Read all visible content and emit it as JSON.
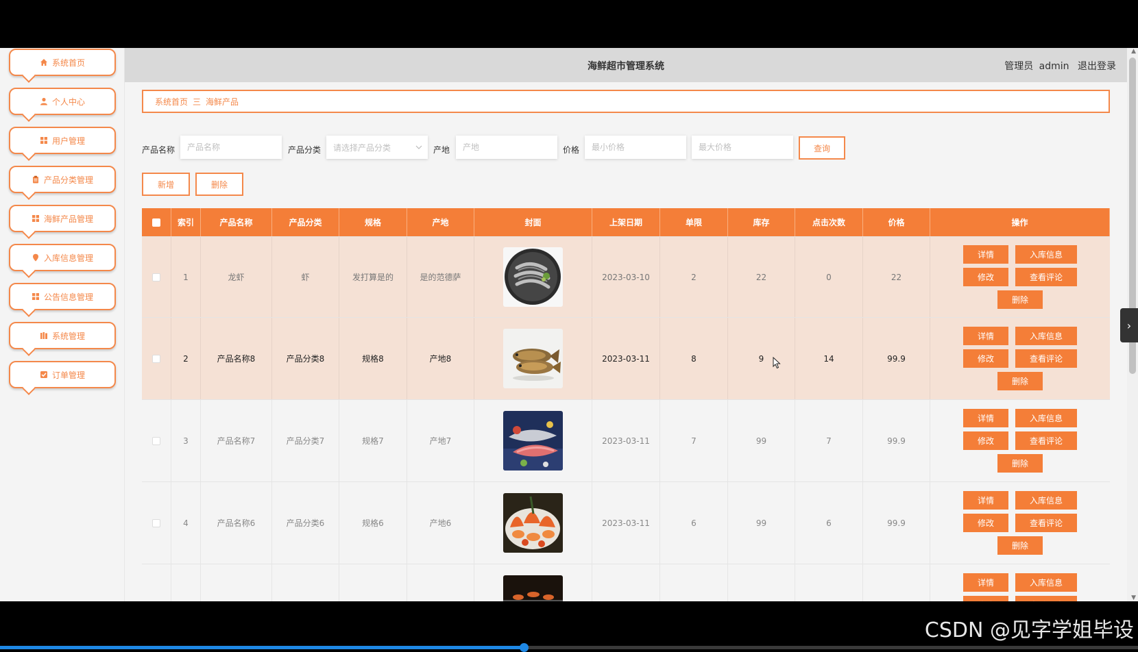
{
  "app_title": "海鲜超市管理系统",
  "header": {
    "role": "管理员",
    "user": "admin",
    "logout": "退出登录"
  },
  "sidebar": {
    "items": [
      {
        "label": "系统首页",
        "icon": "home-icon"
      },
      {
        "label": "个人中心",
        "icon": "user-icon"
      },
      {
        "label": "用户管理",
        "icon": "grid-icon"
      },
      {
        "label": "产品分类管理",
        "icon": "clipboard-icon"
      },
      {
        "label": "海鲜产品管理",
        "icon": "grid-icon"
      },
      {
        "label": "入库信息管理",
        "icon": "pin-icon"
      },
      {
        "label": "公告信息管理",
        "icon": "grid-icon"
      },
      {
        "label": "系统管理",
        "icon": "books-icon"
      },
      {
        "label": "订单管理",
        "icon": "check-icon"
      }
    ]
  },
  "breadcrumb": {
    "home": "系统首页",
    "sep": "三",
    "current": "海鲜产品"
  },
  "search": {
    "name_label": "产品名称",
    "name_placeholder": "产品名称",
    "category_label": "产品分类",
    "category_placeholder": "请选择产品分类",
    "origin_label": "产地",
    "origin_placeholder": "产地",
    "price_label": "价格",
    "min_price_placeholder": "最小价格",
    "max_price_placeholder": "最大价格",
    "query_button": "查询"
  },
  "actions": {
    "add": "新增",
    "delete": "删除"
  },
  "table": {
    "columns": [
      "索引",
      "产品名称",
      "产品分类",
      "规格",
      "产地",
      "封面",
      "上架日期",
      "单限",
      "库存",
      "点击次数",
      "价格",
      "操作"
    ],
    "op_labels": {
      "detail": "详情",
      "stock": "入库信息",
      "edit": "修改",
      "comments": "查看评论",
      "delete": "删除"
    },
    "rows": [
      {
        "index": "1",
        "name": "龙虾",
        "category": "虾",
        "spec": "发打算是的",
        "origin": "是的范德萨",
        "cover": "shrimp-image",
        "date": "2023-03-10",
        "limit": "2",
        "stock": "22",
        "clicks": "0",
        "price": "22"
      },
      {
        "index": "2",
        "name": "产品名称8",
        "category": "产品分类8",
        "spec": "规格8",
        "origin": "产地8",
        "cover": "fish-image",
        "date": "2023-03-11",
        "limit": "8",
        "stock": "9",
        "clicks": "14",
        "price": "99.9"
      },
      {
        "index": "3",
        "name": "产品名称7",
        "category": "产品分类7",
        "spec": "规格7",
        "origin": "产地7",
        "cover": "salmon-image",
        "date": "2023-03-11",
        "limit": "7",
        "stock": "99",
        "clicks": "7",
        "price": "99.9"
      },
      {
        "index": "4",
        "name": "产品名称6",
        "category": "产品分类6",
        "spec": "规格6",
        "origin": "产地6",
        "cover": "seafood-platter-image",
        "date": "2023-03-11",
        "limit": "6",
        "stock": "99",
        "clicks": "6",
        "price": "99.9"
      },
      {
        "index": "",
        "name": "",
        "category": "",
        "spec": "",
        "origin": "",
        "cover": "grill-image",
        "date": "",
        "limit": "",
        "stock": "",
        "clicks": "",
        "price": ""
      }
    ]
  },
  "watermark": "CSDN @见字学姐毕设",
  "video_progress": 0.46,
  "colors": {
    "accent": "#f47e38",
    "highlight_row": "#f5e1d5",
    "header_bg": "#d9d9d9"
  }
}
